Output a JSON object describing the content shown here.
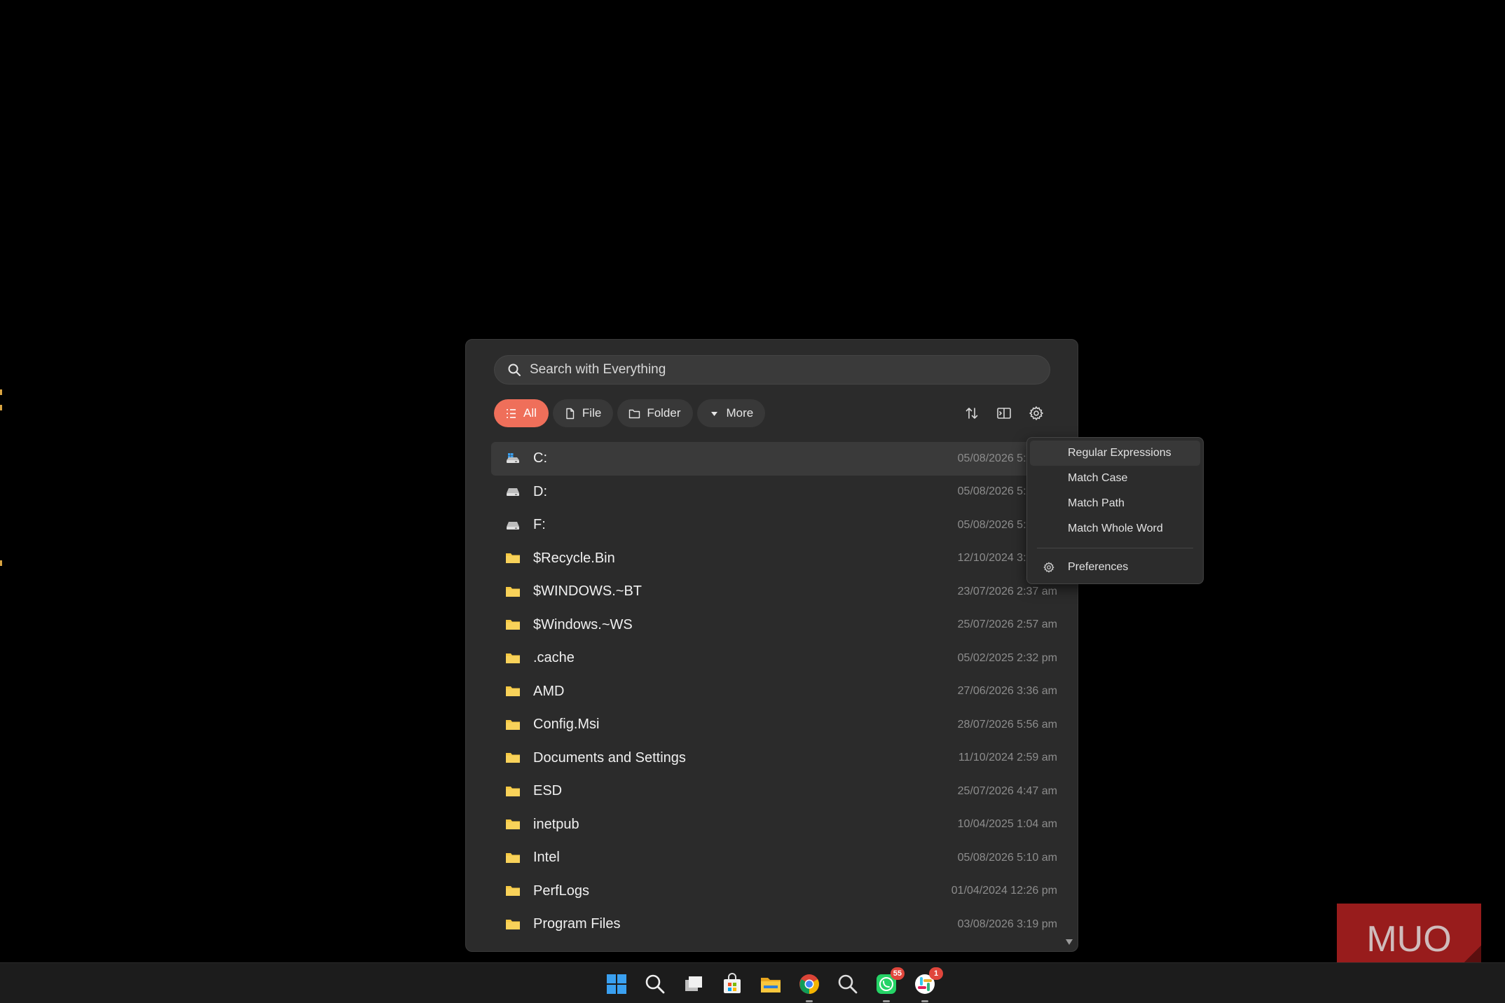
{
  "search": {
    "placeholder": "Search with Everything"
  },
  "filters": [
    {
      "label": "All",
      "active": true
    },
    {
      "label": "File"
    },
    {
      "label": "Folder"
    },
    {
      "label": "More"
    }
  ],
  "results": [
    {
      "name": "C:",
      "date": "05/08/2026 5:10 am",
      "icon": "drive-system-icon"
    },
    {
      "name": "D:",
      "date": "05/08/2026 5:10 am",
      "icon": "drive-icon"
    },
    {
      "name": "F:",
      "date": "05/08/2026 5:10 am",
      "icon": "drive-icon"
    },
    {
      "name": "$Recycle.Bin",
      "date": "12/10/2024 3:06 pm",
      "icon": "folder-icon"
    },
    {
      "name": "$WINDOWS.~BT",
      "date": "23/07/2026 2:37 am",
      "icon": "folder-icon"
    },
    {
      "name": "$Windows.~WS",
      "date": "25/07/2026 2:57 am",
      "icon": "folder-icon"
    },
    {
      "name": ".cache",
      "date": "05/02/2025 2:32 pm",
      "icon": "folder-icon"
    },
    {
      "name": "AMD",
      "date": "27/06/2026 3:36 am",
      "icon": "folder-icon"
    },
    {
      "name": "Config.Msi",
      "date": "28/07/2026 5:56 am",
      "icon": "folder-icon"
    },
    {
      "name": "Documents and Settings",
      "date": "11/10/2024 2:59 am",
      "icon": "folder-icon"
    },
    {
      "name": "ESD",
      "date": "25/07/2026 4:47 am",
      "icon": "folder-icon"
    },
    {
      "name": "inetpub",
      "date": "10/04/2025 1:04 am",
      "icon": "folder-icon"
    },
    {
      "name": "Intel",
      "date": "05/08/2026 5:10 am",
      "icon": "folder-icon"
    },
    {
      "name": "PerfLogs",
      "date": "01/04/2024 12:26 pm",
      "icon": "folder-icon"
    },
    {
      "name": "Program Files",
      "date": "03/08/2026 3:19 pm",
      "icon": "folder-icon"
    }
  ],
  "menu": {
    "items": [
      {
        "label": "Regular Expressions"
      },
      {
        "label": "Match Case"
      },
      {
        "label": "Match Path"
      },
      {
        "label": "Match Whole Word"
      }
    ],
    "preferences": "Preferences"
  },
  "taskbar": {
    "whatsapp_badge": "55",
    "slack_badge": "1"
  },
  "watermark": "MUO",
  "colors": {
    "accent": "#ef6f5a",
    "window_bg": "#2b2b2b",
    "folder": "#f5c842"
  }
}
